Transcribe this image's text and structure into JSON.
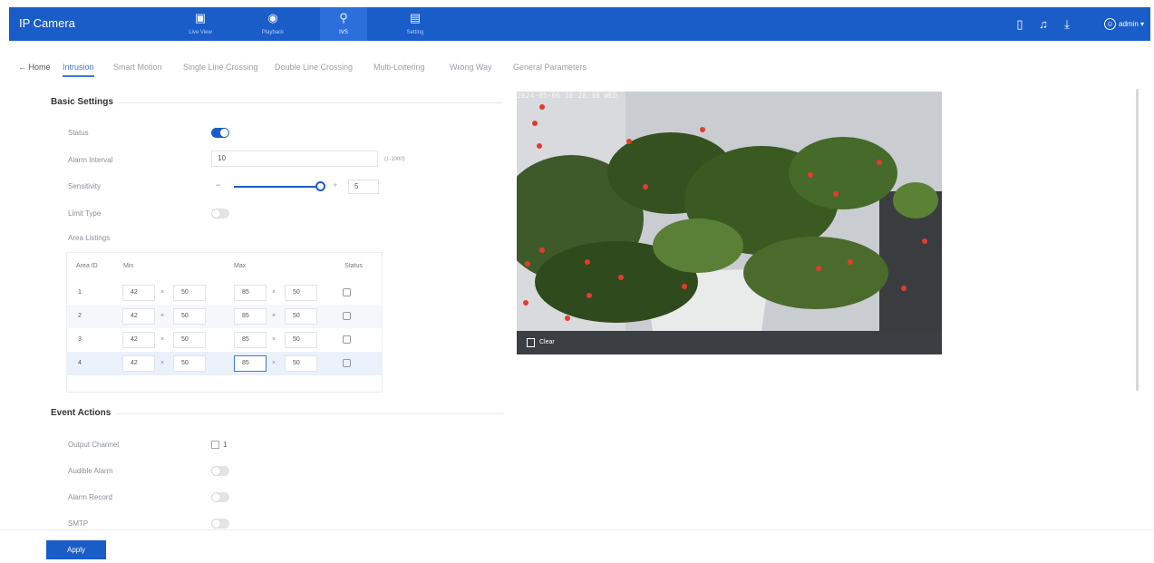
{
  "topbar": {
    "app_title": "IP Camera",
    "nav": [
      {
        "icon": "live-view-icon",
        "label": "Live View"
      },
      {
        "icon": "playback-icon",
        "label": "Playback"
      },
      {
        "icon": "ivs-icon",
        "label": "IVS"
      },
      {
        "icon": "setting-icon",
        "label": "Setting"
      }
    ],
    "user": "admin"
  },
  "tabs": {
    "home": "Home",
    "items": [
      "Intrusion",
      "Smart Motion",
      "Single Line Crossing",
      "Double Line Crossing",
      "Multi-Loitering",
      "Wrong Way",
      "General Parameters"
    ],
    "active": "Intrusion"
  },
  "basic_settings": {
    "title": "Basic Settings",
    "status_label": "Status",
    "status_on": true,
    "alarm_interval_label": "Alarm Interval",
    "alarm_interval_value": "10",
    "alarm_interval_range": "(1-1000)",
    "sensitivity_label": "Sensitivity",
    "sensitivity_value": "5",
    "limit_type_label": "Limit Type",
    "area_listings_label": "Area Listings"
  },
  "area_table": {
    "headers": [
      "Area ID",
      "Min",
      "Max",
      "Status"
    ],
    "rows": [
      {
        "id": "1",
        "min_w": "42",
        "min_h": "50",
        "max_w": "85",
        "max_h": "50"
      },
      {
        "id": "2",
        "min_w": "42",
        "min_h": "50",
        "max_w": "85",
        "max_h": "50"
      },
      {
        "id": "3",
        "min_w": "42",
        "min_h": "50",
        "max_w": "85",
        "max_h": "50"
      },
      {
        "id": "4",
        "min_w": "42",
        "min_h": "50",
        "max_w": "85",
        "max_h": "50"
      }
    ],
    "separator": "×"
  },
  "event_actions": {
    "title": "Event Actions",
    "output_channel_label": "Output Channel",
    "output_channel_value": "1",
    "audible_alarm_label": "Audible Alarm",
    "alarm_record_label": "Alarm Record",
    "smtp_label": "SMTP"
  },
  "video": {
    "timestamp": "2024-05-06  18:28:30 WED",
    "clear_label": "Clear"
  },
  "apply_label": "Apply"
}
